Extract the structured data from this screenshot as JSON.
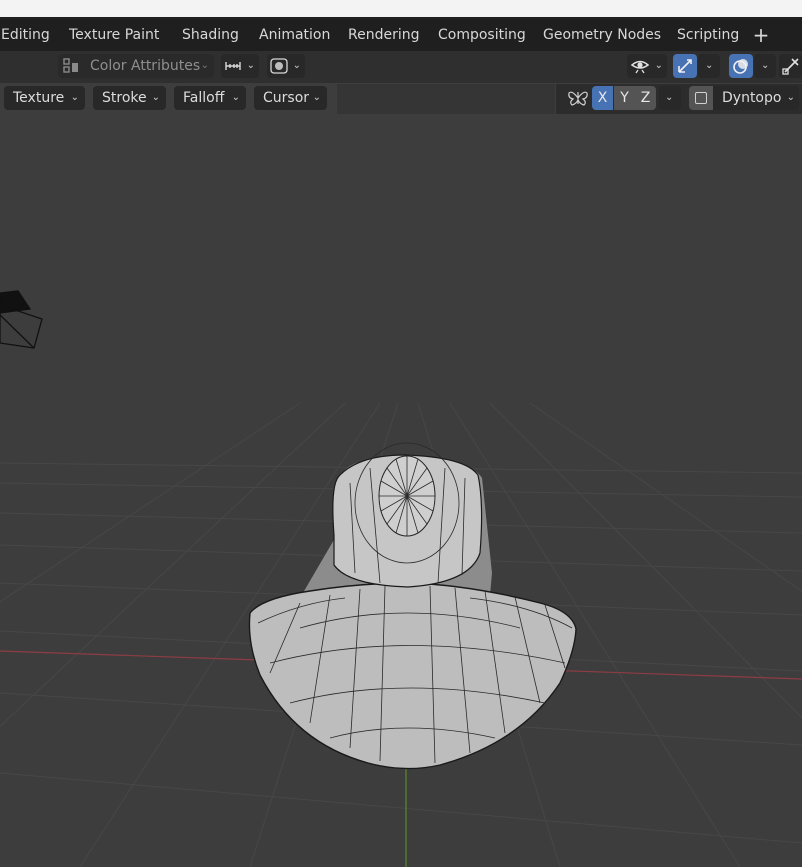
{
  "workspace_tabs": [
    {
      "label": "Editing"
    },
    {
      "label": "Texture Paint"
    },
    {
      "label": "Shading"
    },
    {
      "label": "Animation"
    },
    {
      "label": "Rendering"
    },
    {
      "label": "Compositing"
    },
    {
      "label": "Geometry Nodes"
    },
    {
      "label": "Scripting"
    }
  ],
  "header": {
    "color_attributes_label": "Color Attributes"
  },
  "tool_menus": [
    {
      "label": "Texture"
    },
    {
      "label": "Stroke"
    },
    {
      "label": "Falloff"
    },
    {
      "label": "Cursor"
    }
  ],
  "symmetry": {
    "axes": [
      {
        "label": "X",
        "active": true
      },
      {
        "label": "Y",
        "active": false
      },
      {
        "label": "Z",
        "active": false
      }
    ]
  },
  "dyntopo": {
    "label": "Dyntopo",
    "enabled": false
  },
  "icons": {
    "add_workspace": "plus-icon",
    "color_attributes": "color-attributes-icon",
    "symmetry": "butterfly-icon",
    "visibility": "eye-icon",
    "gizmo": "gizmo-icon",
    "overlay": "overlay-icon",
    "xray": "xray-icon"
  },
  "colors": {
    "active_blue": "#4772b3",
    "x_axis": "#a0424a",
    "y_axis": "#5d8a2b",
    "background": "#3d3d3d"
  }
}
